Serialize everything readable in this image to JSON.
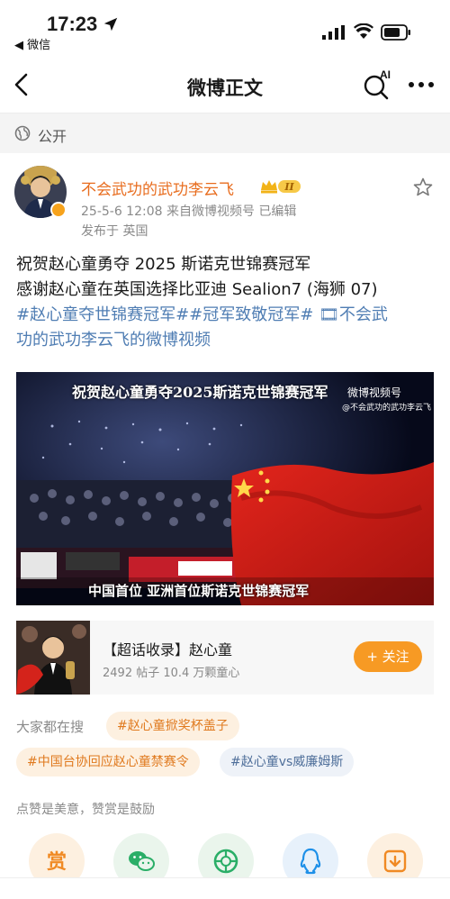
{
  "status_bar": {
    "time": "17:23",
    "back_app": "◀ 微信"
  },
  "nav": {
    "title": "微博正文",
    "ai_label": "AI"
  },
  "visibility": {
    "label": "公开"
  },
  "post": {
    "author": "不会武功的武功李云飞",
    "level_badge": "II",
    "date": "25-5-6 12:08",
    "source_prefix": "来自",
    "source": "微博视频号",
    "edited": "已编辑",
    "location": "发布于 英国",
    "text_line1": "祝贺赵心童勇夺 2025 斯诺克世锦赛冠军",
    "text_line2": "感谢赵心童在英国选择比亚迪 Sealion7 (海狮 07)",
    "hashtag1": "#赵心童夺世锦赛冠军#",
    "hashtag2": "#冠军致敬冠军#",
    "video_link_part1": " 🎞不会武",
    "video_link_part2": "功的武功李云飞的微博视频"
  },
  "video": {
    "top_caption": "祝贺赵心童勇夺2025斯诺克世锦赛冠军",
    "bottom_caption": "中国首位 亚洲首位斯诺克世锦赛冠军",
    "watermark": "微博视频号",
    "watermark_sub": "@不会武功的武功李云飞"
  },
  "topic_card": {
    "title": "【超话收录】赵心童",
    "stats": "2492 帖子  10.4 万颗童心",
    "follow_label": "+ 关注"
  },
  "search": {
    "label": "大家都在搜",
    "chips": [
      "#赵心童掀奖杯盖子",
      "#中国台协回应赵心童禁赛令",
      "#赵心童vs威廉姆斯"
    ]
  },
  "like_hint": "点赞是美意，赞赏是鼓励",
  "actions": {
    "reward_label": "赏"
  },
  "colors": {
    "accent_orange": "#f79a24",
    "link_blue": "#4f7db3",
    "username_orange": "#e86d1f"
  }
}
